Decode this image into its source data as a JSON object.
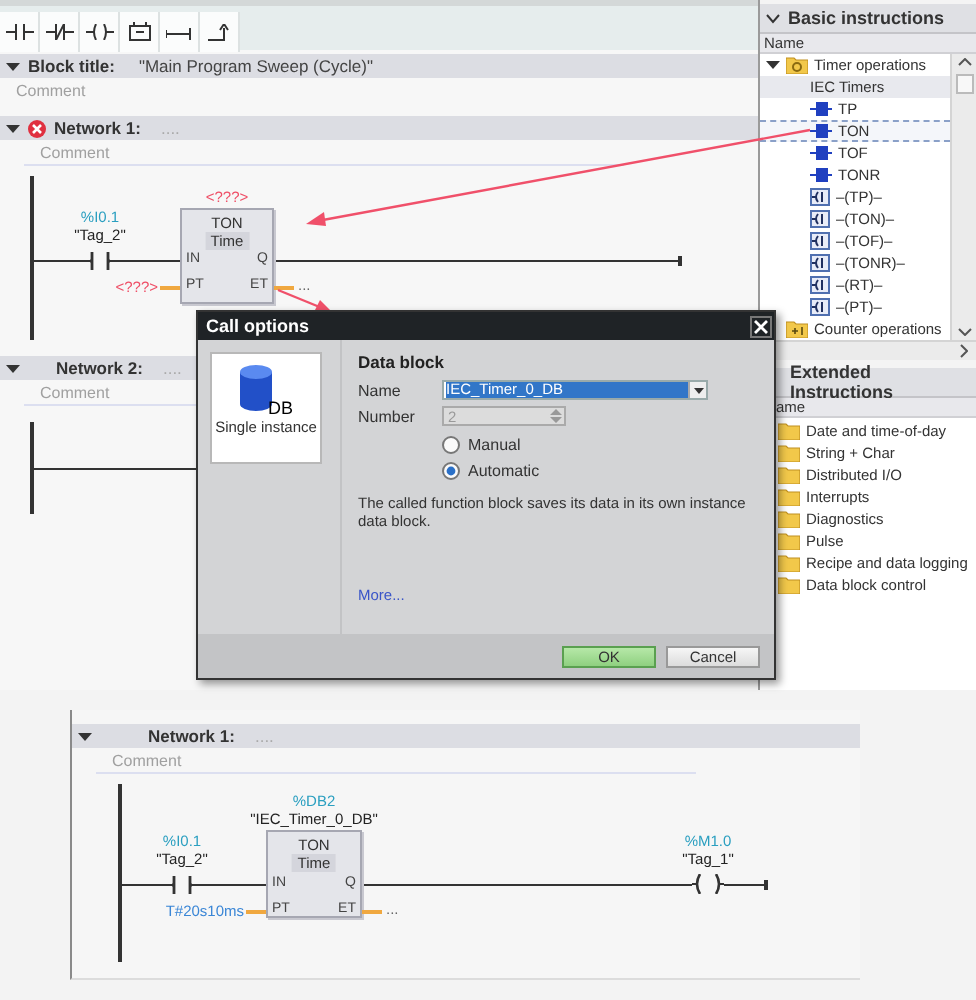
{
  "toolbar": {
    "tools": [
      {
        "kind": "no-contact"
      },
      {
        "kind": "nc-contact"
      },
      {
        "kind": "coil"
      },
      {
        "kind": "empty-box"
      },
      {
        "kind": "open-branch"
      },
      {
        "kind": "close-branch"
      }
    ]
  },
  "editor": {
    "block_title": {
      "label": "Block title:",
      "value": "\"Main Program Sweep (Cycle)\"",
      "expanded": true,
      "comment": "Comment"
    },
    "networks": [
      {
        "title": "Network 1:",
        "error": true,
        "expanded": true,
        "title_placeholder": "....",
        "comment": "Comment",
        "contact": {
          "address": "%I0.1",
          "tag": "\"Tag_2\""
        },
        "timer": {
          "instance": [
            {
              "text": "<???>",
              "kind": "missing"
            }
          ],
          "type": "TON",
          "subtype": "Time",
          "pins": {
            "in": "IN",
            "pt": "PT",
            "q": "Q",
            "et": "ET"
          },
          "pt": {
            "text": "<???>",
            "kind": "missing"
          },
          "et": {
            "text": "...",
            "kind": "placeholder"
          }
        }
      },
      {
        "title": "Network 2:",
        "error": false,
        "expanded": true,
        "title_placeholder": "....",
        "comment": "Comment"
      }
    ]
  },
  "basic_instructions": {
    "title": "Basic instructions",
    "expanded": true,
    "column": "Name",
    "tree": [
      {
        "label": "Timer operations",
        "kind": "folder",
        "expanded": true,
        "selected": false,
        "children": [
          {
            "label": "IEC Timers",
            "kind": "group",
            "selected": false,
            "children": [
              {
                "label": "TP",
                "kind": "box",
                "selected": false
              },
              {
                "label": "TON",
                "kind": "box",
                "selected": true
              },
              {
                "label": "TOF",
                "kind": "box",
                "selected": false
              },
              {
                "label": "TONR",
                "kind": "box",
                "selected": false
              },
              {
                "label": "–(TP)–",
                "kind": "coil",
                "selected": false
              },
              {
                "label": "–(TON)–",
                "kind": "coil",
                "selected": false
              },
              {
                "label": "–(TOF)–",
                "kind": "coil",
                "selected": false
              },
              {
                "label": "–(TONR)–",
                "kind": "coil",
                "selected": false
              },
              {
                "label": "–(RT)–",
                "kind": "coil",
                "selected": false
              },
              {
                "label": "–(PT)–",
                "kind": "coil",
                "selected": false
              }
            ]
          }
        ]
      },
      {
        "label": "Counter operations",
        "kind": "counter",
        "selected": false
      }
    ]
  },
  "extended_instructions": {
    "title": "Extended Instructions",
    "column": "ame",
    "items": [
      {
        "label": "Date and time-of-day"
      },
      {
        "label": "String + Char"
      },
      {
        "label": "Distributed I/O"
      },
      {
        "label": "Interrupts"
      },
      {
        "label": "Diagnostics"
      },
      {
        "label": "Pulse"
      },
      {
        "label": "Recipe and data logging"
      },
      {
        "label": "Data block control"
      }
    ]
  },
  "dialog": {
    "title": "Call options",
    "option": {
      "label": "Single instance",
      "icon_text": "DB",
      "selected": true
    },
    "section": "Data block",
    "name_field": {
      "label": "Name",
      "value": "IEC_Timer_0_DB"
    },
    "number_field": {
      "label": "Number",
      "value": "2",
      "disabled": true
    },
    "modes": [
      {
        "label": "Manual",
        "selected": false
      },
      {
        "label": "Automatic",
        "selected": true
      }
    ],
    "description": "The called function block saves its data in its own instance data block.",
    "link": "More...",
    "buttons": [
      {
        "label": "OK",
        "kind": "primary"
      },
      {
        "label": "Cancel",
        "kind": "secondary"
      }
    ]
  },
  "result": {
    "networks": [
      {
        "title": "Network 1:",
        "error": false,
        "expanded": true,
        "title_placeholder": "....",
        "comment": "Comment",
        "contact": {
          "address": "%I0.1",
          "tag": "\"Tag_2\""
        },
        "timer": {
          "instance": [
            {
              "text": "%DB2",
              "kind": "address"
            },
            {
              "text": "\"IEC_Timer_0_DB\"",
              "kind": "symbol"
            }
          ],
          "type": "TON",
          "subtype": "Time",
          "pins": {
            "in": "IN",
            "pt": "PT",
            "q": "Q",
            "et": "ET"
          },
          "pt": {
            "text": "T#20s10ms",
            "kind": "constant"
          },
          "et": {
            "text": "...",
            "kind": "placeholder"
          }
        },
        "coil": {
          "address": "%M1.0",
          "tag": "\"Tag_1\""
        }
      }
    ]
  }
}
